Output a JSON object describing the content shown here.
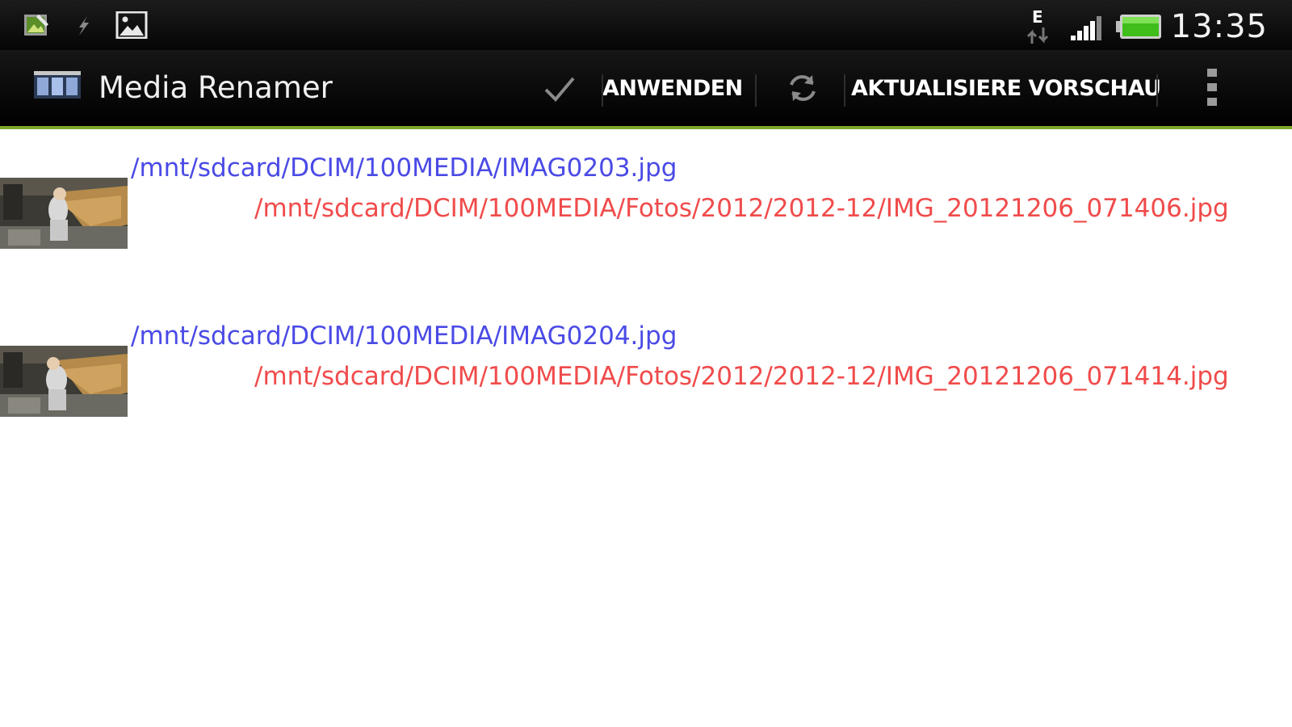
{
  "status_bar": {
    "icons": [
      "photo-edit-icon",
      "usb-debug-icon",
      "image-notification-icon",
      "edge-network-icon",
      "signal-strength-icon",
      "battery-icon"
    ],
    "network_label": "E",
    "time": "13:35"
  },
  "action_bar": {
    "title": "Media Renamer",
    "apply_icon": "checkmark-icon",
    "apply_label": "ANWENDEN",
    "refresh_icon": "refresh-icon",
    "refresh_label": "AKTUALISIERE VORSCHAU",
    "menu_icon": "overflow-menu-icon",
    "accent_color": "#7aa52a"
  },
  "colors": {
    "source_path": "#4a4ae6",
    "target_path": "#f04b4b"
  },
  "files": [
    {
      "source": "/mnt/sdcard/DCIM/100MEDIA/IMAG0203.jpg",
      "target": "/mnt/sdcard/DCIM/100MEDIA/Fotos/2012/2012-12/IMG_20121206_071406.jpg"
    },
    {
      "source": "/mnt/sdcard/DCIM/100MEDIA/IMAG0204.jpg",
      "target": "/mnt/sdcard/DCIM/100MEDIA/Fotos/2012/2012-12/IMG_20121206_071414.jpg"
    }
  ]
}
